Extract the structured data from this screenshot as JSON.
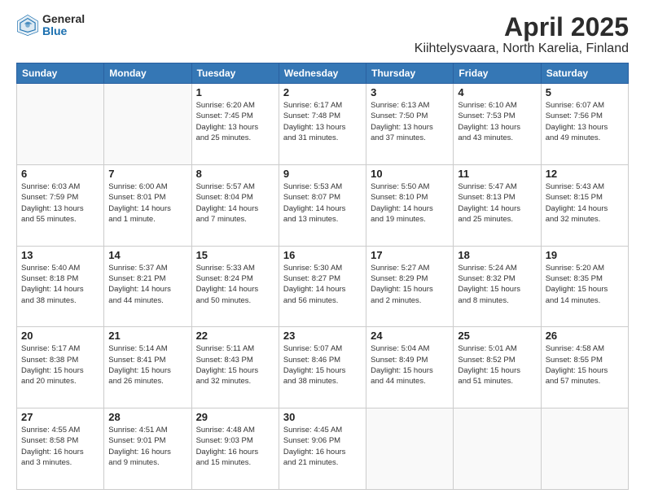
{
  "header": {
    "logo_general": "General",
    "logo_blue": "Blue",
    "title": "April 2025",
    "subtitle": "Kiihtelysvaara, North Karelia, Finland"
  },
  "weekdays": [
    "Sunday",
    "Monday",
    "Tuesday",
    "Wednesday",
    "Thursday",
    "Friday",
    "Saturday"
  ],
  "weeks": [
    [
      {
        "day": "",
        "info": ""
      },
      {
        "day": "",
        "info": ""
      },
      {
        "day": "1",
        "info": "Sunrise: 6:20 AM\nSunset: 7:45 PM\nDaylight: 13 hours\nand 25 minutes."
      },
      {
        "day": "2",
        "info": "Sunrise: 6:17 AM\nSunset: 7:48 PM\nDaylight: 13 hours\nand 31 minutes."
      },
      {
        "day": "3",
        "info": "Sunrise: 6:13 AM\nSunset: 7:50 PM\nDaylight: 13 hours\nand 37 minutes."
      },
      {
        "day": "4",
        "info": "Sunrise: 6:10 AM\nSunset: 7:53 PM\nDaylight: 13 hours\nand 43 minutes."
      },
      {
        "day": "5",
        "info": "Sunrise: 6:07 AM\nSunset: 7:56 PM\nDaylight: 13 hours\nand 49 minutes."
      }
    ],
    [
      {
        "day": "6",
        "info": "Sunrise: 6:03 AM\nSunset: 7:59 PM\nDaylight: 13 hours\nand 55 minutes."
      },
      {
        "day": "7",
        "info": "Sunrise: 6:00 AM\nSunset: 8:01 PM\nDaylight: 14 hours\nand 1 minute."
      },
      {
        "day": "8",
        "info": "Sunrise: 5:57 AM\nSunset: 8:04 PM\nDaylight: 14 hours\nand 7 minutes."
      },
      {
        "day": "9",
        "info": "Sunrise: 5:53 AM\nSunset: 8:07 PM\nDaylight: 14 hours\nand 13 minutes."
      },
      {
        "day": "10",
        "info": "Sunrise: 5:50 AM\nSunset: 8:10 PM\nDaylight: 14 hours\nand 19 minutes."
      },
      {
        "day": "11",
        "info": "Sunrise: 5:47 AM\nSunset: 8:13 PM\nDaylight: 14 hours\nand 25 minutes."
      },
      {
        "day": "12",
        "info": "Sunrise: 5:43 AM\nSunset: 8:15 PM\nDaylight: 14 hours\nand 32 minutes."
      }
    ],
    [
      {
        "day": "13",
        "info": "Sunrise: 5:40 AM\nSunset: 8:18 PM\nDaylight: 14 hours\nand 38 minutes."
      },
      {
        "day": "14",
        "info": "Sunrise: 5:37 AM\nSunset: 8:21 PM\nDaylight: 14 hours\nand 44 minutes."
      },
      {
        "day": "15",
        "info": "Sunrise: 5:33 AM\nSunset: 8:24 PM\nDaylight: 14 hours\nand 50 minutes."
      },
      {
        "day": "16",
        "info": "Sunrise: 5:30 AM\nSunset: 8:27 PM\nDaylight: 14 hours\nand 56 minutes."
      },
      {
        "day": "17",
        "info": "Sunrise: 5:27 AM\nSunset: 8:29 PM\nDaylight: 15 hours\nand 2 minutes."
      },
      {
        "day": "18",
        "info": "Sunrise: 5:24 AM\nSunset: 8:32 PM\nDaylight: 15 hours\nand 8 minutes."
      },
      {
        "day": "19",
        "info": "Sunrise: 5:20 AM\nSunset: 8:35 PM\nDaylight: 15 hours\nand 14 minutes."
      }
    ],
    [
      {
        "day": "20",
        "info": "Sunrise: 5:17 AM\nSunset: 8:38 PM\nDaylight: 15 hours\nand 20 minutes."
      },
      {
        "day": "21",
        "info": "Sunrise: 5:14 AM\nSunset: 8:41 PM\nDaylight: 15 hours\nand 26 minutes."
      },
      {
        "day": "22",
        "info": "Sunrise: 5:11 AM\nSunset: 8:43 PM\nDaylight: 15 hours\nand 32 minutes."
      },
      {
        "day": "23",
        "info": "Sunrise: 5:07 AM\nSunset: 8:46 PM\nDaylight: 15 hours\nand 38 minutes."
      },
      {
        "day": "24",
        "info": "Sunrise: 5:04 AM\nSunset: 8:49 PM\nDaylight: 15 hours\nand 44 minutes."
      },
      {
        "day": "25",
        "info": "Sunrise: 5:01 AM\nSunset: 8:52 PM\nDaylight: 15 hours\nand 51 minutes."
      },
      {
        "day": "26",
        "info": "Sunrise: 4:58 AM\nSunset: 8:55 PM\nDaylight: 15 hours\nand 57 minutes."
      }
    ],
    [
      {
        "day": "27",
        "info": "Sunrise: 4:55 AM\nSunset: 8:58 PM\nDaylight: 16 hours\nand 3 minutes."
      },
      {
        "day": "28",
        "info": "Sunrise: 4:51 AM\nSunset: 9:01 PM\nDaylight: 16 hours\nand 9 minutes."
      },
      {
        "day": "29",
        "info": "Sunrise: 4:48 AM\nSunset: 9:03 PM\nDaylight: 16 hours\nand 15 minutes."
      },
      {
        "day": "30",
        "info": "Sunrise: 4:45 AM\nSunset: 9:06 PM\nDaylight: 16 hours\nand 21 minutes."
      },
      {
        "day": "",
        "info": ""
      },
      {
        "day": "",
        "info": ""
      },
      {
        "day": "",
        "info": ""
      }
    ]
  ]
}
